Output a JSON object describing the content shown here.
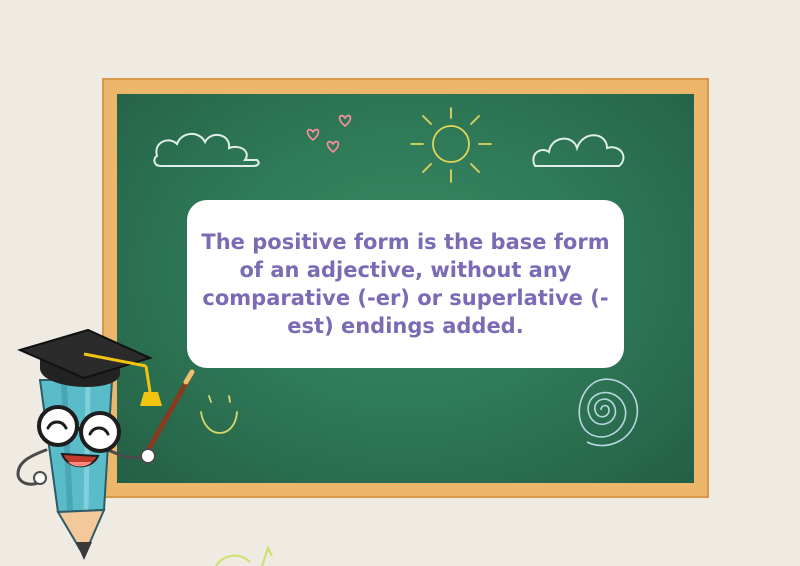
{
  "card": {
    "text": "The positive form is the base form of an adjective, without any comparative (-er) or superlative (-est) endings added."
  },
  "icons": [
    "cloud-icon",
    "heart-icon",
    "sun-icon",
    "spiral-icon",
    "smiley-icon",
    "pencil-teacher-icon"
  ],
  "colors": {
    "background": "#efeae2",
    "frame": "#ecb76a",
    "board": "#2f7a58",
    "text": "#7b6bb5",
    "pencil": "#5bbcc9"
  }
}
